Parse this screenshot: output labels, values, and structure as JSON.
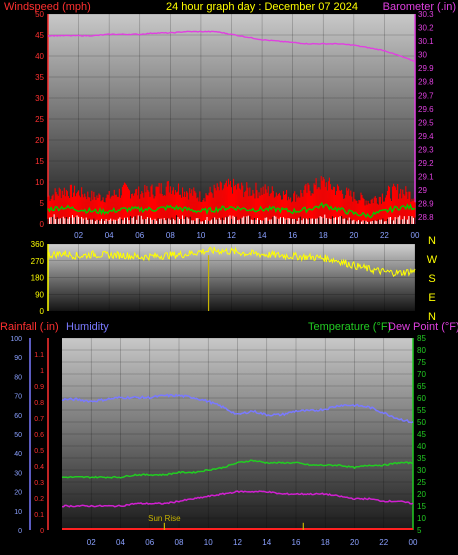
{
  "header": {
    "left_label": "Windspeed (mph)",
    "title": "24 hour graph day : December 07 2024",
    "right_label": "Barometer (.in)"
  },
  "colors": {
    "windspeed": "#ff0000",
    "gust": "#ff0000",
    "avg_wind": "#00cc00",
    "min_wind": "#ffffff",
    "barometer": "#e040e0",
    "direction": "#ffff00",
    "humidity": "#7a7aff",
    "temperature": "#22cc22",
    "dewpoint": "#d020d0",
    "rainfall": "#ff2020",
    "sunrise": "#c8b400",
    "axis_left_top": "#ff3030",
    "axis_right_top": "#e040e0",
    "axis_dir": "#ffff00",
    "axis_humidity": "#7a7aff",
    "axis_rain": "#ff3030",
    "axis_temp": "#22cc22"
  },
  "chart_data": [
    {
      "type": "line",
      "id": "wind-baro",
      "x_tick_labels": [
        "02",
        "04",
        "06",
        "08",
        "10",
        "12",
        "14",
        "16",
        "18",
        "20",
        "22",
        "00"
      ],
      "y_left": {
        "label": "Windspeed (mph)",
        "ticks": [
          "0",
          "5",
          "10",
          "15",
          "20",
          "25",
          "30",
          "35",
          "40",
          "45",
          "50"
        ],
        "ylim": [
          0,
          50
        ]
      },
      "y_right": {
        "label": "Barometer (.in)",
        "ticks": [
          "28.8",
          "28.9",
          "29",
          "29.1",
          "29.2",
          "29.3",
          "29.4",
          "29.5",
          "29.6",
          "29.7",
          "29.8",
          "29.9",
          "30",
          "30.1",
          "30.2",
          "30.3"
        ],
        "ylim": [
          28.75,
          30.3
        ]
      },
      "series": [
        {
          "key": "barometer",
          "axis": "right",
          "x": [
            0,
            1,
            2,
            3,
            4,
            5,
            6,
            7,
            8,
            9,
            10,
            11,
            12,
            13,
            14,
            15,
            16,
            17,
            18,
            19,
            20,
            21,
            22,
            23,
            24
          ],
          "values": [
            30.14,
            30.14,
            30.14,
            30.14,
            30.15,
            30.15,
            30.15,
            30.16,
            30.16,
            30.17,
            30.17,
            30.17,
            30.15,
            30.13,
            30.11,
            30.1,
            30.09,
            30.08,
            30.08,
            30.08,
            30.07,
            30.05,
            30.03,
            29.99,
            29.95
          ]
        },
        {
          "key": "gust",
          "axis": "left",
          "x": [
            0,
            1,
            2,
            3,
            4,
            5,
            6,
            7,
            8,
            9,
            10,
            11,
            12,
            13,
            14,
            15,
            16,
            17,
            18,
            19,
            20,
            21,
            22,
            23,
            24
          ],
          "values": [
            8,
            10,
            9,
            8,
            8,
            10,
            9,
            10,
            11,
            10,
            8,
            10,
            11,
            10,
            10,
            9,
            8,
            10,
            12,
            10,
            8,
            7,
            9,
            10,
            8
          ]
        },
        {
          "key": "windspeed",
          "axis": "left",
          "x": [
            0,
            1,
            2,
            3,
            4,
            5,
            6,
            7,
            8,
            9,
            10,
            11,
            12,
            13,
            14,
            15,
            16,
            17,
            18,
            19,
            20,
            21,
            22,
            23,
            24
          ],
          "values": [
            5,
            6,
            6,
            5,
            5,
            6,
            6,
            6,
            7,
            6,
            5,
            6,
            7,
            6,
            6,
            6,
            5,
            6,
            8,
            6,
            5,
            4,
            5,
            6,
            5
          ]
        },
        {
          "key": "avg_wind",
          "axis": "left",
          "x": [
            0,
            1,
            2,
            3,
            4,
            5,
            6,
            7,
            8,
            9,
            10,
            11,
            12,
            13,
            14,
            15,
            16,
            17,
            18,
            19,
            20,
            21,
            22,
            23,
            24
          ],
          "values": [
            3.5,
            4,
            3.5,
            3,
            3,
            3.5,
            3.5,
            3.5,
            4,
            3.5,
            3,
            3.5,
            4,
            3.5,
            3.5,
            3.5,
            3,
            3.5,
            4.5,
            3.5,
            2.5,
            2,
            3,
            4,
            4
          ]
        },
        {
          "key": "min_wind",
          "axis": "left",
          "x": [
            0,
            1,
            2,
            3,
            4,
            5,
            6,
            7,
            8,
            9,
            10,
            11,
            12,
            13,
            14,
            15,
            16,
            17,
            18,
            19,
            20,
            21,
            22,
            23,
            24
          ],
          "values": [
            1.5,
            2,
            1.5,
            1,
            1,
            1.5,
            1.5,
            1,
            1.5,
            1.5,
            1,
            1.5,
            1.5,
            1.5,
            1,
            1.5,
            1,
            1.5,
            2,
            1.5,
            1,
            0.5,
            1,
            1.5,
            1.5
          ]
        }
      ]
    },
    {
      "type": "scatter",
      "id": "direction",
      "y_left_ticks": [
        "0",
        "90",
        "180",
        "270",
        "360"
      ],
      "ylim": [
        0,
        360
      ],
      "compass_labels": [
        "N",
        "W",
        "S",
        "E",
        "N"
      ],
      "series": [
        {
          "key": "direction",
          "x": [
            0,
            1,
            2,
            3,
            4,
            5,
            6,
            7,
            8,
            9,
            10,
            11,
            12,
            13,
            14,
            15,
            16,
            17,
            18,
            19,
            20,
            21,
            22,
            23,
            24
          ],
          "values": [
            300,
            310,
            295,
            305,
            300,
            300,
            290,
            295,
            300,
            305,
            320,
            325,
            320,
            310,
            305,
            300,
            295,
            290,
            285,
            270,
            245,
            225,
            210,
            205,
            215
          ]
        }
      ],
      "marker": {
        "x": 10.5,
        "label": ""
      }
    },
    {
      "type": "line",
      "id": "temp-hum-rain",
      "header_left": "Rainfall (.in)",
      "header_humidity": "Humidity",
      "header_temp": "Temperature (°F)",
      "header_dew": "Dew Point (°F)",
      "x_tick_labels": [
        "02",
        "04",
        "06",
        "08",
        "10",
        "12",
        "14",
        "16",
        "18",
        "20",
        "22",
        "00"
      ],
      "y_humidity_ticks": [
        "0",
        "10",
        "20",
        "30",
        "40",
        "50",
        "60",
        "70",
        "80",
        "90",
        "100"
      ],
      "y_rain_ticks": [
        "0",
        "0.1",
        "0.2",
        "0.3",
        "0.4",
        "0.5",
        "0.6",
        "0.7",
        "0.8",
        "0.9",
        "1",
        "1.1"
      ],
      "y_temp_ticks": [
        "5",
        "10",
        "15",
        "20",
        "25",
        "30",
        "35",
        "40",
        "45",
        "50",
        "55",
        "60",
        "65",
        "70",
        "75",
        "80",
        "85"
      ],
      "humidity_lim": [
        0,
        100
      ],
      "temp_lim": [
        5,
        85
      ],
      "series": [
        {
          "key": "humidity",
          "x": [
            0,
            1,
            2,
            3,
            4,
            5,
            6,
            7,
            8,
            9,
            10,
            11,
            12,
            13,
            14,
            15,
            16,
            17,
            18,
            19,
            20,
            21,
            22,
            23,
            24
          ],
          "values": [
            68,
            68,
            67,
            68,
            69,
            69,
            69,
            70,
            70,
            69,
            67,
            64,
            60,
            62,
            60,
            60,
            62,
            62,
            63,
            65,
            65,
            64,
            61,
            58,
            56
          ]
        },
        {
          "key": "temperature",
          "x": [
            0,
            1,
            2,
            3,
            4,
            5,
            6,
            7,
            8,
            9,
            10,
            11,
            12,
            13,
            14,
            15,
            16,
            17,
            18,
            19,
            20,
            21,
            22,
            23,
            24
          ],
          "values": [
            27,
            27,
            27,
            27,
            27,
            28,
            28,
            28,
            29,
            29,
            30,
            31,
            33,
            34,
            33,
            33,
            33,
            32,
            32,
            32,
            31,
            32,
            32,
            33,
            33
          ]
        },
        {
          "key": "dewpoint",
          "x": [
            0,
            1,
            2,
            3,
            4,
            5,
            6,
            7,
            8,
            9,
            10,
            11,
            12,
            13,
            14,
            15,
            16,
            17,
            18,
            19,
            20,
            21,
            22,
            23,
            24
          ],
          "values": [
            15,
            15,
            15,
            15,
            15,
            16,
            16,
            16,
            17,
            18,
            19,
            20,
            21,
            21,
            21,
            20,
            20,
            20,
            20,
            19,
            18,
            18,
            17,
            17,
            16
          ]
        },
        {
          "key": "rainfall",
          "x": [
            0,
            24
          ],
          "values": [
            0,
            0
          ]
        }
      ],
      "markers": [
        {
          "x": 7,
          "label": "Sun Rise"
        },
        {
          "x": 16.5,
          "label": ""
        }
      ]
    }
  ]
}
